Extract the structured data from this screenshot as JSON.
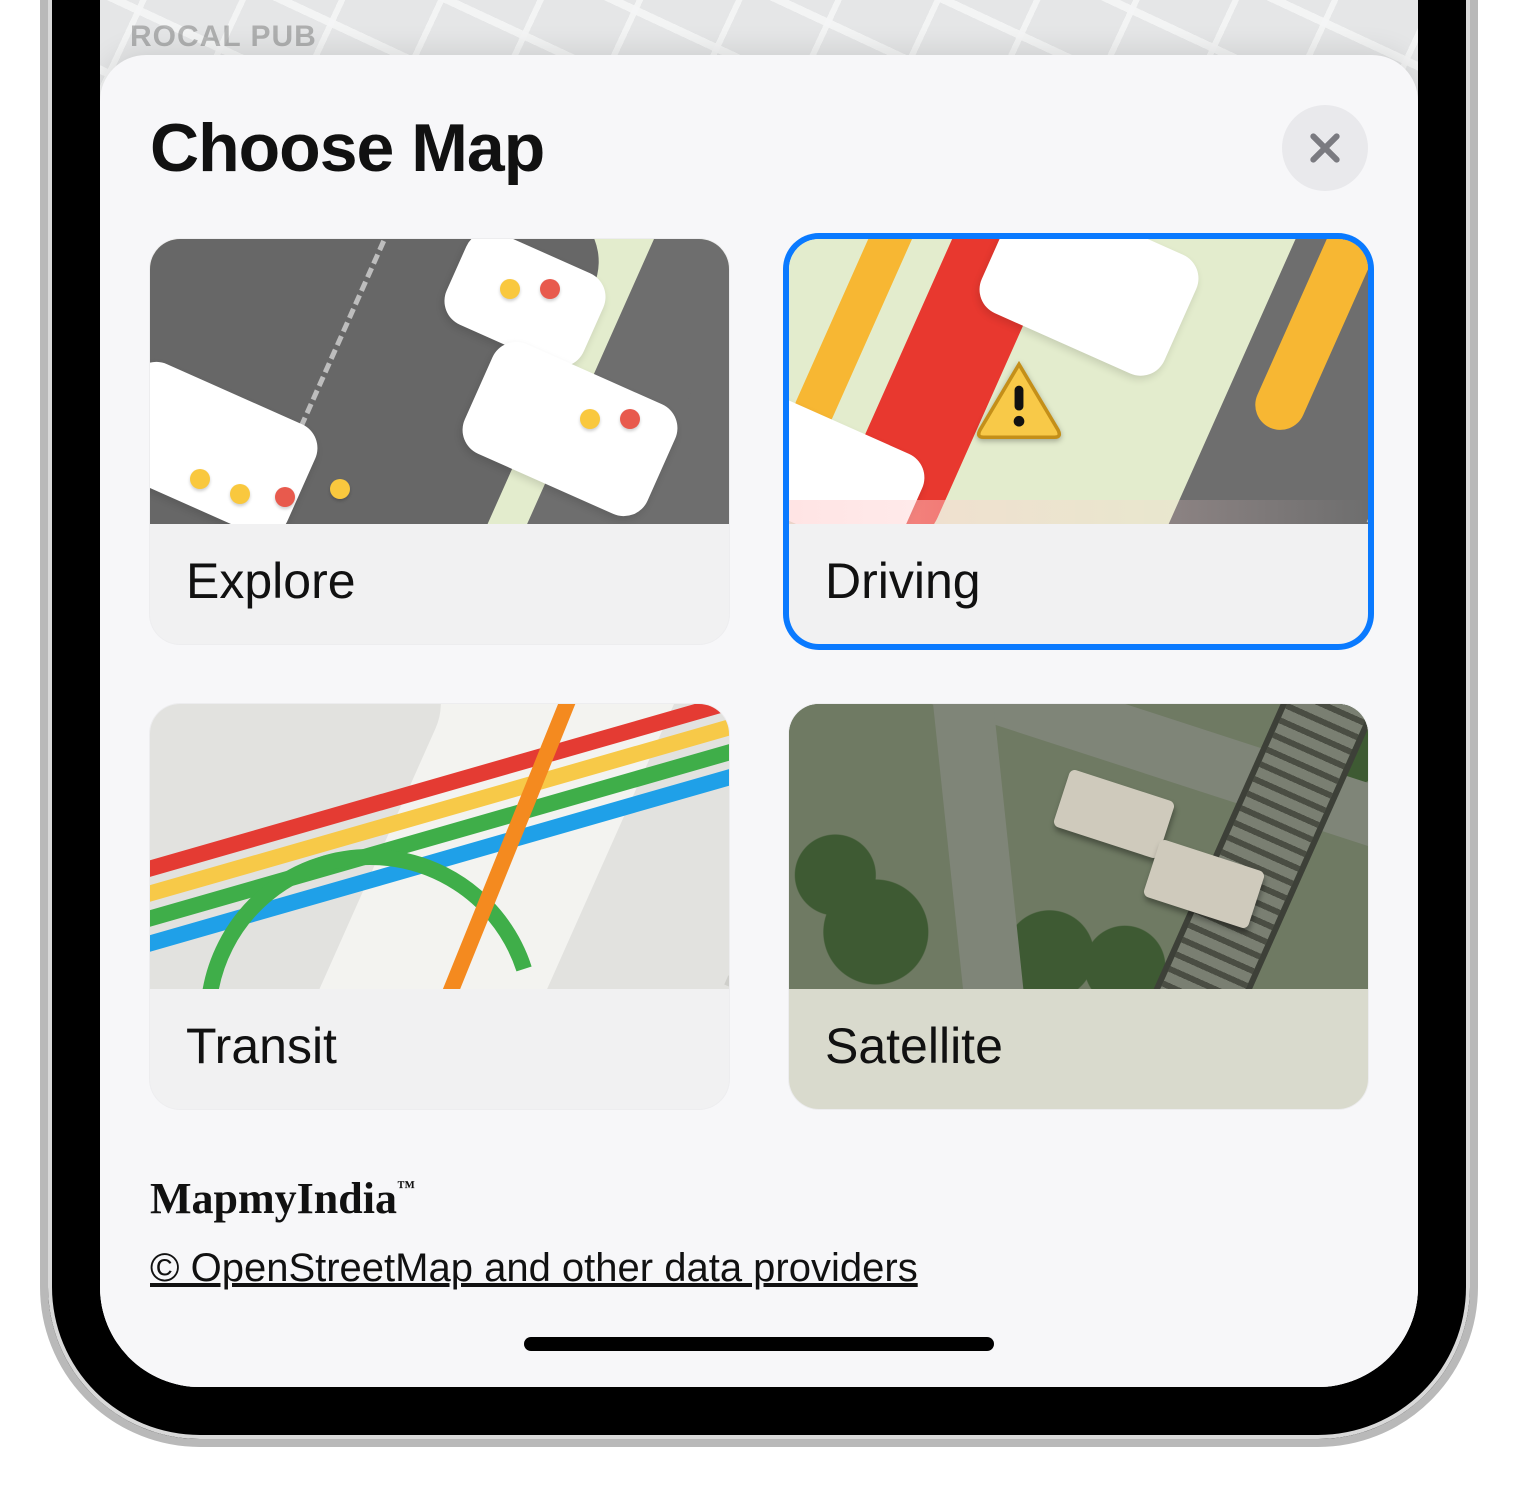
{
  "background_label": "ROCAL PUB",
  "sheet": {
    "title": "Choose Map",
    "close_icon": "close-icon"
  },
  "options": [
    {
      "key": "explore",
      "label": "Explore",
      "selected": false
    },
    {
      "key": "driving",
      "label": "Driving",
      "selected": true
    },
    {
      "key": "transit",
      "label": "Transit",
      "selected": false
    },
    {
      "key": "satellite",
      "label": "Satellite",
      "selected": false
    }
  ],
  "footer": {
    "brand": "MapmyIndia",
    "attribution": "© OpenStreetMap and other data providers"
  },
  "colors": {
    "accent": "#0a7aff",
    "traffic_red": "#e8382f",
    "traffic_yellow": "#f7b733",
    "transit_red": "#e43b33",
    "transit_yellow": "#f7c948",
    "transit_green": "#3fae49",
    "transit_blue": "#1fa0e8",
    "transit_orange": "#f48a1f"
  }
}
